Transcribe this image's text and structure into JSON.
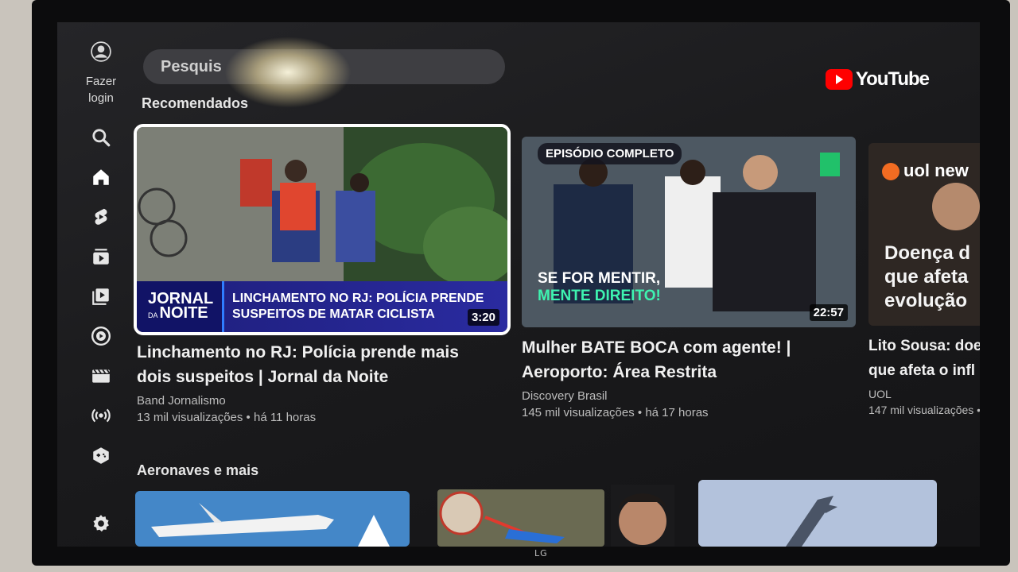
{
  "tv": {
    "brand": "LG"
  },
  "sidebar": {
    "login_label_line1": "Fazer",
    "login_label_line2": "login",
    "icons": [
      "account-icon",
      "search-icon",
      "home-icon",
      "shorts-icon",
      "subscriptions-icon",
      "library-icon",
      "music-icon",
      "movies-icon",
      "live-icon",
      "gaming-icon",
      "settings-icon"
    ]
  },
  "search": {
    "placeholder": "Pesquis"
  },
  "brand": {
    "logo_text": "YouTube",
    "accent": "#ff0000"
  },
  "sections": {
    "recommended": "Recomendados",
    "aircraft": "Aeronaves e mais"
  },
  "videos": [
    {
      "title_line1": "Linchamento no RJ: Polícia prende mais",
      "title_line2": "dois suspeitos | Jornal da Noite",
      "channel": "Band Jornalismo",
      "meta": "13 mil visualizações • há 11 horas",
      "duration": "3:20",
      "banner_logo_top": "JORNAL",
      "banner_logo_bottom": "NOITE",
      "banner_logo_da": "DA",
      "banner_line1": "LINCHAMENTO NO RJ: POLÍCIA PRENDE",
      "banner_line2": "SUSPEITOS DE MATAR CICLISTA"
    },
    {
      "title_line1": "Mulher BATE BOCA com agente! |",
      "title_line2": "Aeroporto: Área Restrita",
      "channel": "Discovery Brasil",
      "meta": "145 mil visualizações • há 17 horas",
      "duration": "22:57",
      "badge": "EPISÓDIO COMPLETO",
      "overlay_line1": "SE FOR MENTIR,",
      "overlay_line2": "MENTE DIREITO!"
    },
    {
      "title_line1": "Lito Sousa: doe",
      "title_line2": "que afeta o infl",
      "channel": "UOL",
      "meta": "147 mil visualizações •",
      "logo": "uol new",
      "overlay_line1": "Doença d",
      "overlay_line2": "que afeta",
      "overlay_line3": "evolução"
    }
  ]
}
